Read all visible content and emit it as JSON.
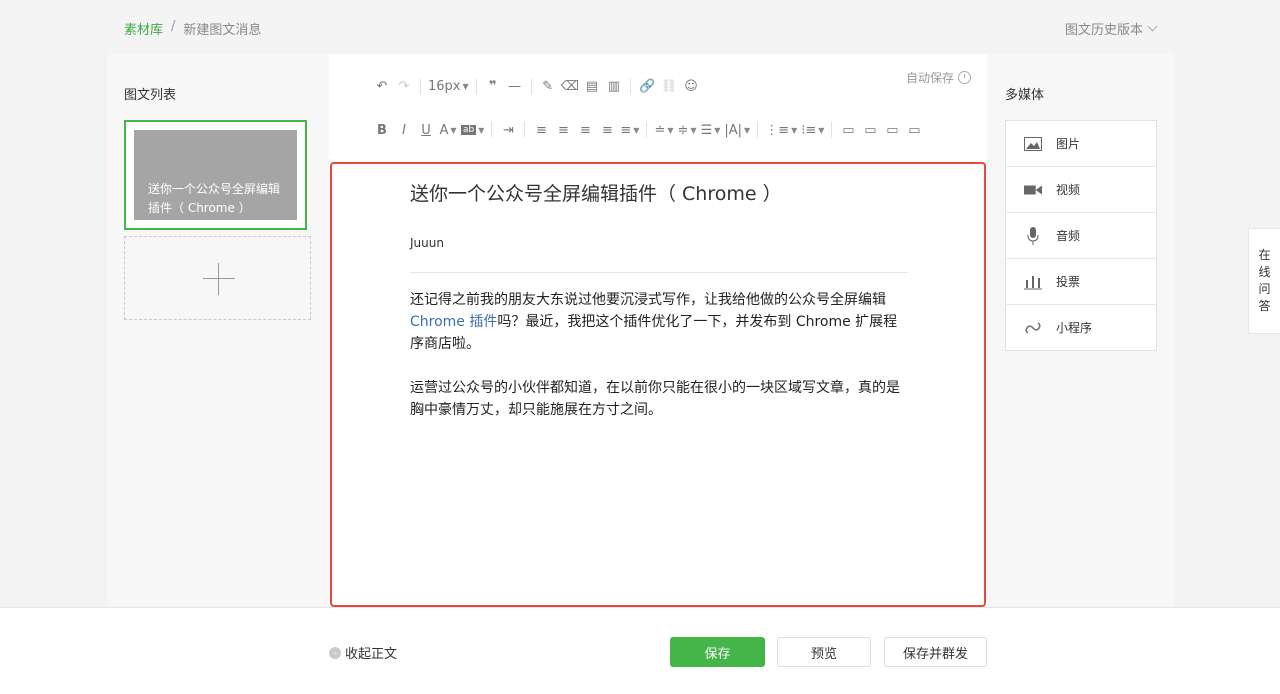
{
  "breadcrumb": {
    "root": "素材库",
    "separator": "/",
    "current": "新建图文消息"
  },
  "history_label": "图文历史版本",
  "left": {
    "title": "图文列表",
    "cards": [
      {
        "title": "送你一个公众号全屏编辑插件（ Chrome ）"
      }
    ]
  },
  "editor": {
    "autosave": "自动保存",
    "font_size": "16px",
    "title": "送你一个公众号全屏编辑插件（ Chrome ）",
    "author": "Juuun",
    "p1_a": "还记得之前我的朋友大东说过他要沉浸式写作，让我给他做的公众号全屏编辑",
    "p1_link": "Chrome 插件",
    "p1_b": "吗？最近，我把这个插件优化了一下，并发布到 Chrome 扩展程序商店啦。",
    "p2": "运营过公众号的小伙伴都知道，在以前你只能在很小的一块区域写文章，真的是胸中豪情万丈，却只能施展在方寸之间。"
  },
  "media": {
    "title": "多媒体",
    "items": [
      {
        "label": "图片",
        "icon": "image-icon"
      },
      {
        "label": "视频",
        "icon": "video-icon"
      },
      {
        "label": "音频",
        "icon": "microphone-icon"
      },
      {
        "label": "投票",
        "icon": "poll-icon"
      },
      {
        "label": "小程序",
        "icon": "mini-program-icon"
      }
    ]
  },
  "side_tab": [
    "在",
    "线",
    "问",
    "答"
  ],
  "footer": {
    "collapse": "收起正文",
    "save": "保存",
    "preview": "预览",
    "save_send": "保存并群发"
  },
  "colors": {
    "accent": "#44b549",
    "highlight_border": "#e5493a",
    "link": "#3b6fb5"
  }
}
